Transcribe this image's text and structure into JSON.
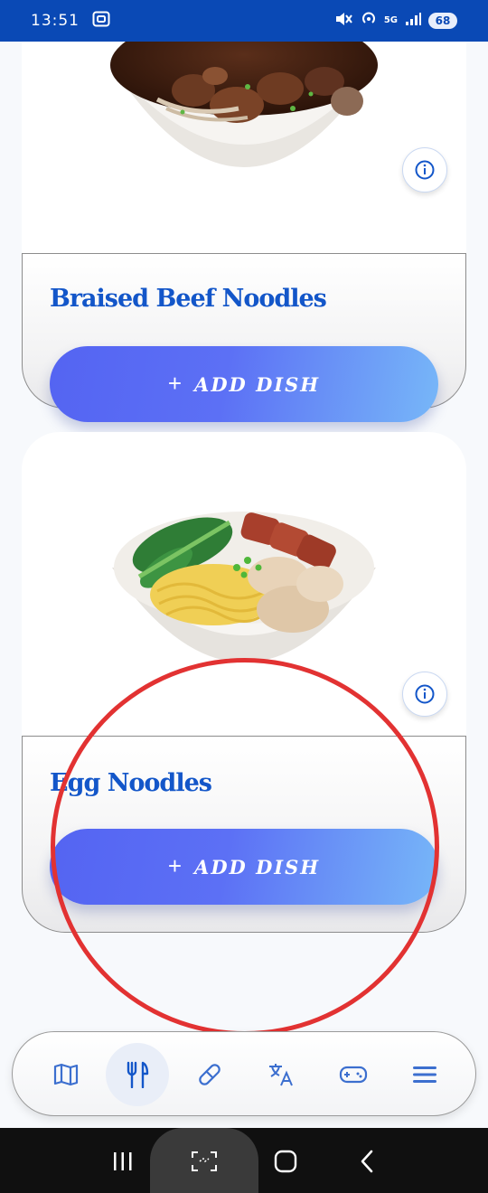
{
  "status_bar": {
    "time": "13:51",
    "network_label": "5G",
    "battery_level": "68"
  },
  "dishes": [
    {
      "name": "Braised Beef Noodles",
      "add_label": "ADD DISH",
      "add_icon": "+"
    },
    {
      "name": "Egg Noodles",
      "add_label": "ADD DISH",
      "add_icon": "+"
    }
  ],
  "bottom_nav": {
    "items": [
      {
        "icon": "map-icon",
        "active": false
      },
      {
        "icon": "fork-knife-icon",
        "active": true
      },
      {
        "icon": "pill-icon",
        "active": false
      },
      {
        "icon": "translate-icon",
        "active": false
      },
      {
        "icon": "gamepad-icon",
        "active": false
      },
      {
        "icon": "menu-icon",
        "active": false
      }
    ]
  },
  "colors": {
    "status_bar": "#0a49b5",
    "dish_title": "#1356c9",
    "button_gradient_start": "#5464f2",
    "button_gradient_end": "#77b7f8",
    "annotation": "#e23232",
    "nav_icon": "#3c6fcf"
  }
}
